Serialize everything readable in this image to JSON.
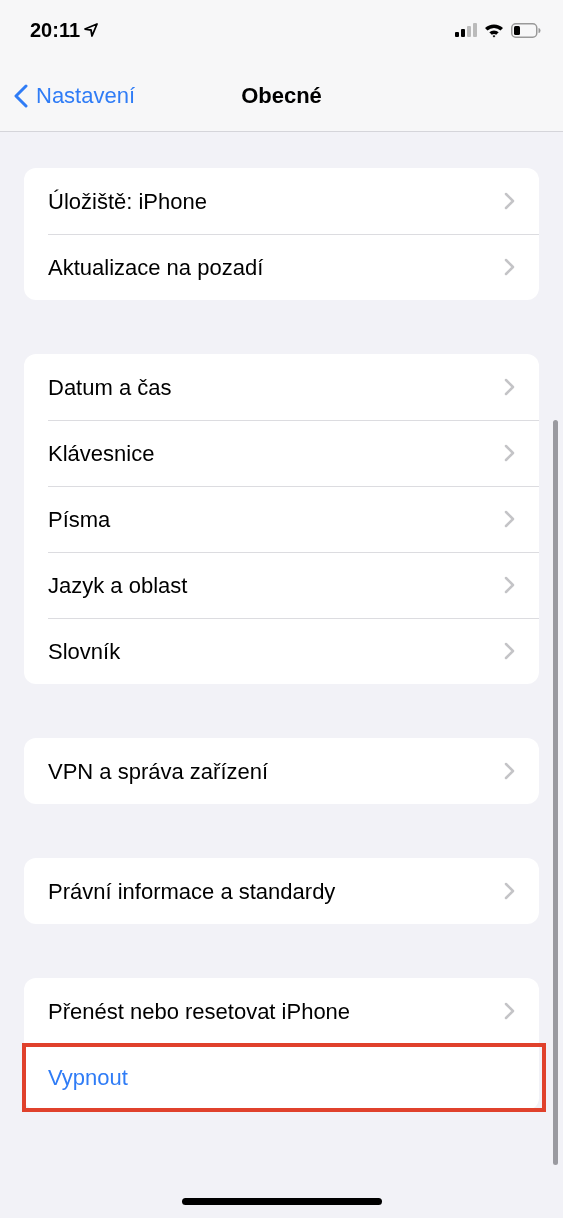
{
  "status_bar": {
    "time": "20:11"
  },
  "nav": {
    "back_label": "Nastavení",
    "title": "Obecné"
  },
  "groups": [
    {
      "rows": [
        {
          "label": "Úložiště: iPhone",
          "kind": "link",
          "highlighted": false
        },
        {
          "label": "Aktualizace na pozadí",
          "kind": "link",
          "highlighted": false
        }
      ]
    },
    {
      "rows": [
        {
          "label": "Datum a čas",
          "kind": "link",
          "highlighted": false
        },
        {
          "label": "Klávesnice",
          "kind": "link",
          "highlighted": false
        },
        {
          "label": "Písma",
          "kind": "link",
          "highlighted": false
        },
        {
          "label": "Jazyk a oblast",
          "kind": "link",
          "highlighted": false
        },
        {
          "label": "Slovník",
          "kind": "link",
          "highlighted": false
        }
      ]
    },
    {
      "rows": [
        {
          "label": "VPN a správa zařízení",
          "kind": "link",
          "highlighted": false
        }
      ]
    },
    {
      "rows": [
        {
          "label": "Právní informace a standardy",
          "kind": "link",
          "highlighted": false
        }
      ]
    },
    {
      "rows": [
        {
          "label": "Přenést nebo resetovat iPhone",
          "kind": "link",
          "highlighted": false
        },
        {
          "label": "Vypnout",
          "kind": "action",
          "highlighted": true
        }
      ]
    }
  ]
}
